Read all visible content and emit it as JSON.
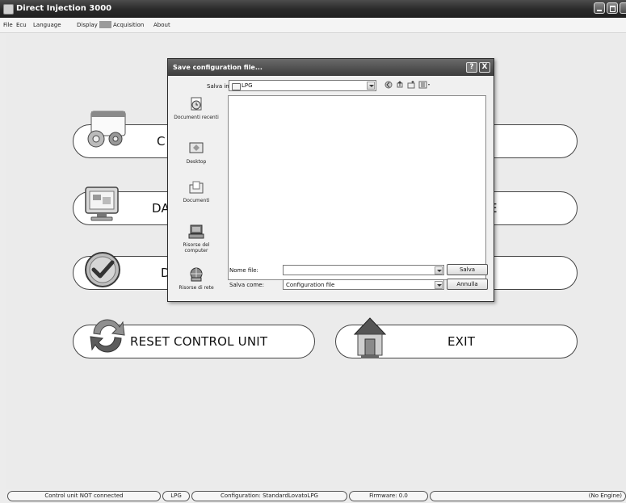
{
  "window": {
    "title": "Direct Injection 3000"
  },
  "menu": [
    "File",
    "Ecu",
    "Language",
    "Display",
    "Acquisition",
    "About"
  ],
  "main_buttons": {
    "configure_partial": "C",
    "data_partial": "DA",
    "data_right_partial": "E",
    "diag_partial": "D",
    "reset": "RESET CONTROL UNIT",
    "exit": "EXIT"
  },
  "dialog": {
    "title": "Save configuration file...",
    "help": "?",
    "close": "X",
    "save_in_label": "Salva in:",
    "save_in_value": "LPG",
    "places": [
      "Documenti recenti",
      "Desktop",
      "Documenti",
      "Risorse del computer",
      "Risorse di rete"
    ],
    "filename_label": "Nome file:",
    "filename_value": "",
    "filetype_label": "Salva come:",
    "filetype_value": "Configuration file",
    "save_button": "Salva",
    "cancel_button": "Annulla"
  },
  "status": {
    "connection": "Control unit NOT connected",
    "fuel": "LPG",
    "configuration": "Configuration: StandardLovatoLPG",
    "firmware": "Firmware: 0.0",
    "engine": "(No Engine)"
  },
  "colors": {
    "titlebar": "#2b2b2b",
    "background": "#ebebeb",
    "pill_border": "#444444"
  }
}
